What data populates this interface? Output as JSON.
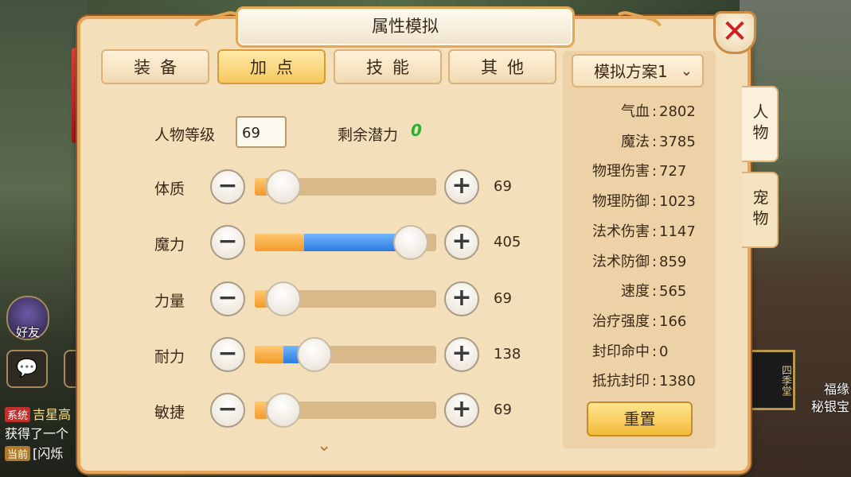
{
  "panel": {
    "title": "属性模拟",
    "close_label": "✕"
  },
  "tabs": [
    {
      "label": "装备",
      "active": false
    },
    {
      "label": "加点",
      "active": true
    },
    {
      "label": "技能",
      "active": false
    },
    {
      "label": "其他",
      "active": false
    }
  ],
  "character": {
    "level_label": "人物等级",
    "level_value": "69",
    "potential_label": "剩余潜力",
    "potential_value": "0"
  },
  "stats": [
    {
      "label": "体质",
      "value": "69",
      "orange": 0.06,
      "blue": 0.0,
      "knob": 0.16
    },
    {
      "label": "魔力",
      "value": "405",
      "orange": 0.27,
      "blue": 0.53,
      "knob": 0.86
    },
    {
      "label": "力量",
      "value": "69",
      "orange": 0.06,
      "blue": 0.0,
      "knob": 0.16
    },
    {
      "label": "耐力",
      "value": "138",
      "orange": 0.16,
      "blue": 0.08,
      "knob": 0.33
    },
    {
      "label": "敏捷",
      "value": "69",
      "orange": 0.06,
      "blue": 0.0,
      "knob": 0.16
    }
  ],
  "minus_label": "−",
  "plus_label": "+",
  "scheme": {
    "selected": "模拟方案1",
    "chevron": "⌄"
  },
  "attributes": [
    {
      "name": "气血",
      "value": "2802"
    },
    {
      "name": "魔法",
      "value": "3785"
    },
    {
      "name": "物理伤害",
      "value": "727"
    },
    {
      "name": "物理防御",
      "value": "1023"
    },
    {
      "name": "法术伤害",
      "value": "1147"
    },
    {
      "name": "法术防御",
      "value": "859"
    },
    {
      "name": "速度",
      "value": "565"
    },
    {
      "name": "治疗强度",
      "value": "166"
    },
    {
      "name": "封印命中",
      "value": "0"
    },
    {
      "name": "抵抗封印",
      "value": "1380"
    }
  ],
  "reset_label": "重置",
  "side_tabs": [
    {
      "label": "人物",
      "active": true
    },
    {
      "label": "宠物",
      "active": false
    }
  ],
  "background": {
    "friend_label": "好友",
    "chat_lines": [
      {
        "tag": "系统",
        "text": "吉星高"
      },
      {
        "tag": "",
        "text": "获得了一个"
      },
      {
        "tag": "当前",
        "text": "[闪烁"
      }
    ],
    "shop_sign": "四季堂",
    "right_texts": [
      "福缘",
      "秘银宝"
    ]
  },
  "colors": {
    "panel_bg": "#f3dfba",
    "border_accent": "#e8a559",
    "active_tab": "#f6c85f",
    "potential_green": "#24b430",
    "close_red": "#d21e1e",
    "slider_orange": "#f39a2a",
    "slider_blue": "#2d7ae0"
  },
  "icons": [
    "close-icon",
    "chevron-down-icon",
    "minus-icon",
    "plus-icon",
    "scroll-down-icon",
    "chat-icon"
  ]
}
